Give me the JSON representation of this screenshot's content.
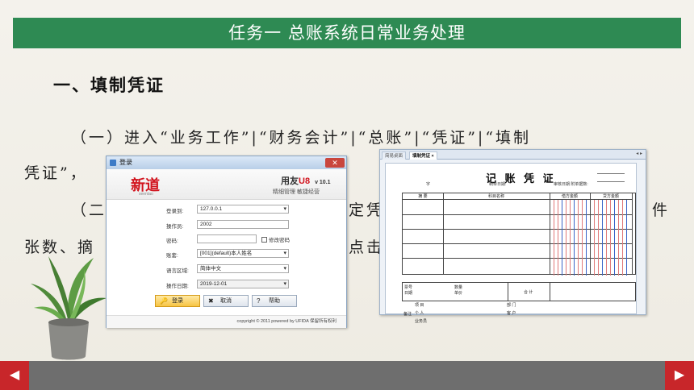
{
  "slide": {
    "title": "任务一 总账系统日常业务处理",
    "heading": "一、填制凭证",
    "para1_line1": "（一）进入“业务工作”|“财务会计”|“总账”|“凭证”|“填制",
    "para1_line2": "凭证”，",
    "para2_start": "（二",
    "para2_mid": "定凭",
    "para2_end": "件",
    "para3_start": "张数、摘",
    "para3_mid": "点击",
    "nav_prev": "◀",
    "nav_next": "▶"
  },
  "login_window": {
    "title": "登录",
    "brand_left": "新道",
    "brand_left_sub": "seentao",
    "brand_right": "用友",
    "brand_right_mark": "U8",
    "version": "v 10.1",
    "slogan": "精细管理  敏捷经营",
    "fields": {
      "server_label": "登录到:",
      "server_value": "127.0.0.1",
      "operator_label": "操作员:",
      "operator_value": "2002",
      "password_label": "密码:",
      "password_value": "",
      "change_password_label": "修改密码",
      "account_label": "账套:",
      "account_value": "[001](default)本人姓名",
      "language_label": "语言区域:",
      "language_value": "简体中文",
      "date_label": "操作日期:",
      "date_value": "2019-12-01"
    },
    "buttons": {
      "login": "登录",
      "cancel": "取消",
      "help": "帮助"
    },
    "footer": "copyright © 2011 powered by UFIDA 保留所有权利"
  },
  "voucher_window": {
    "tabs": [
      "简易桌面",
      "填制凭证"
    ],
    "tab_close": "×",
    "title": "记 账 凭 证",
    "word_label": "字",
    "date_label": "制单日期:",
    "audit_label": "审核日期",
    "attach_label": "附单据数:",
    "columns": [
      "摘 要",
      "科目名称",
      "借方金额",
      "贷方金额"
    ],
    "footer": {
      "ticket_label": "票号\n日期",
      "qty_label": "数量\n单价",
      "total_label": "合 计",
      "remark_label": "备注",
      "project_label": "项 目",
      "dept_label": "部 门",
      "person_label": "个 人",
      "customer_label": "客 户",
      "business_label": "业务员"
    }
  }
}
